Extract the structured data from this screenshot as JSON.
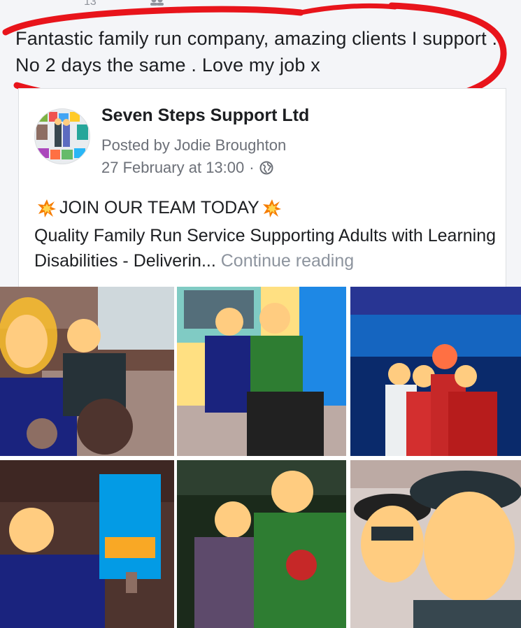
{
  "review": {
    "meta_fragment": "13",
    "text": "Fantastic family run company, amazing clients I support . No 2 days the same . Love my job x"
  },
  "shared_post": {
    "page_name": "Seven Steps Support Ltd",
    "posted_by": "Posted by Jodie Broughton",
    "timestamp": "27 February at 13:00",
    "separator": "·",
    "heading": "JOIN OUR TEAM TODAY",
    "body": "Quality Family Run Service Supporting Adults with Learning Disabilities - Deliverin...",
    "continue_label": "Continue reading"
  },
  "photos": [
    {
      "name": "photo-selfie-sofa"
    },
    {
      "name": "photo-christmas-jumpers-wheelchair"
    },
    {
      "name": "photo-bowling-alley-group"
    },
    {
      "name": "photo-cinema-poster"
    },
    {
      "name": "photo-night-out-pair"
    },
    {
      "name": "photo-hats-selfie"
    }
  ],
  "colors": {
    "annotation_red": "#e8141b",
    "link_grey": "#8d949e",
    "meta_grey": "#6c7078"
  }
}
